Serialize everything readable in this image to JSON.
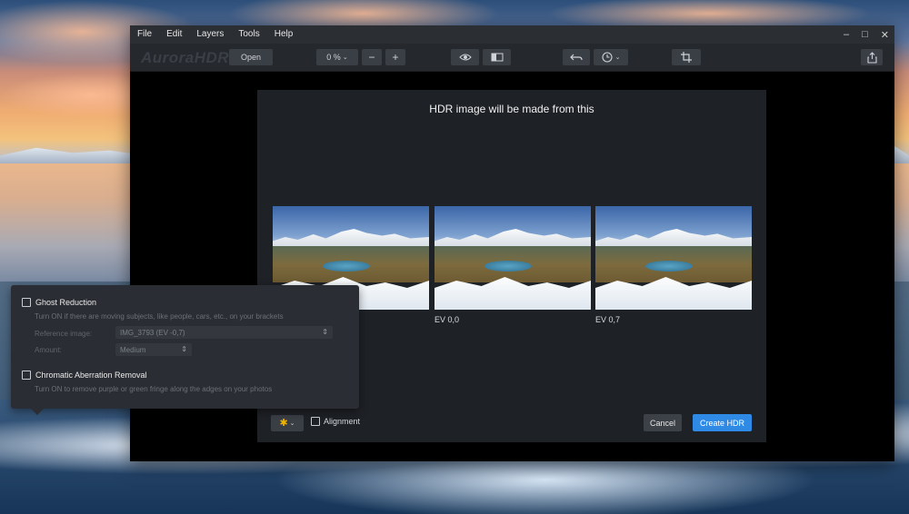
{
  "menu": {
    "items": [
      "File",
      "Edit",
      "Layers",
      "Tools",
      "Help"
    ]
  },
  "window_controls": {
    "minimize": "–",
    "maximize": "□",
    "close": "✕"
  },
  "toolbar": {
    "logo": "AuroraHDR",
    "open_label": "Open",
    "zoom_value": "0 %",
    "zoom_out": "−",
    "zoom_in": "+"
  },
  "dialog": {
    "title": "HDR image will be made from this",
    "images": [
      {
        "ev_label": ""
      },
      {
        "ev_label": "EV 0,0"
      },
      {
        "ev_label": "EV 0,7"
      }
    ],
    "alignment_label": "Alignment",
    "cancel_label": "Cancel",
    "create_label": "Create HDR",
    "accent_color": "#2f8ae5"
  },
  "popover": {
    "ghost_title": "Ghost Reduction",
    "ghost_desc": "Turn ON if there are moving subjects, like people, cars, etc., on your brackets",
    "reference_label": "Reference image:",
    "reference_value": "IMG_3793 (EV -0,7)",
    "amount_label": "Amount:",
    "amount_value": "Medium",
    "chromatic_title": "Chromatic Aberration Removal",
    "chromatic_desc": "Turn ON to remove purple or green fringe along the adges on your photos"
  }
}
